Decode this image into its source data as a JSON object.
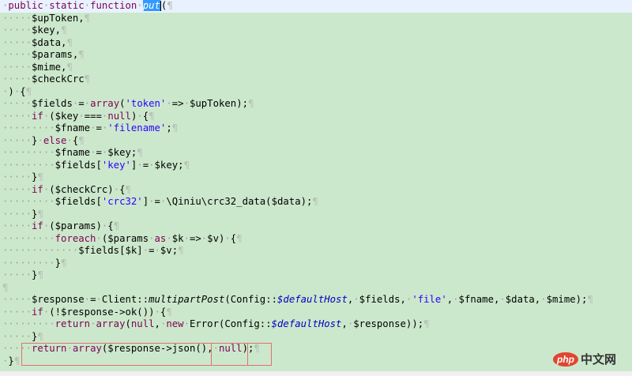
{
  "colors": {
    "keyword": "#7f0055",
    "string": "#2a00ff",
    "static_field": "#0000c0",
    "background": "#cce8cc",
    "selection": "#3399ff",
    "annotation_box": "#e07070"
  },
  "code_lines": [
    {
      "indent": 1,
      "current": true,
      "cursor": true,
      "tokens": [
        [
          "k",
          "public"
        ],
        [
          "w",
          " "
        ],
        [
          "k",
          "static"
        ],
        [
          "w",
          " "
        ],
        [
          "k",
          "function"
        ],
        [
          "w",
          " "
        ],
        [
          "x",
          "put"
        ],
        [
          "p",
          "("
        ]
      ]
    },
    {
      "indent": 5,
      "tokens": [
        [
          "p",
          "$upToken,"
        ]
      ]
    },
    {
      "indent": 5,
      "tokens": [
        [
          "p",
          "$key,"
        ]
      ]
    },
    {
      "indent": 5,
      "tokens": [
        [
          "p",
          "$data,"
        ]
      ]
    },
    {
      "indent": 5,
      "tokens": [
        [
          "p",
          "$params,"
        ]
      ]
    },
    {
      "indent": 5,
      "tokens": [
        [
          "p",
          "$mime,"
        ]
      ]
    },
    {
      "indent": 5,
      "tokens": [
        [
          "p",
          "$checkCrc"
        ]
      ]
    },
    {
      "indent": 1,
      "tokens": [
        [
          "p",
          ")"
        ],
        [
          "w",
          " "
        ],
        [
          "p",
          "{"
        ]
      ]
    },
    {
      "indent": 5,
      "tokens": [
        [
          "p",
          "$fields"
        ],
        [
          "w",
          " "
        ],
        [
          "p",
          "="
        ],
        [
          "w",
          " "
        ],
        [
          "k",
          "array"
        ],
        [
          "p",
          "("
        ],
        [
          "s",
          "'token'"
        ],
        [
          "w",
          " "
        ],
        [
          "p",
          "=>"
        ],
        [
          "w",
          " "
        ],
        [
          "p",
          "$upToken);"
        ]
      ]
    },
    {
      "indent": 5,
      "tokens": [
        [
          "k",
          "if"
        ],
        [
          "w",
          " "
        ],
        [
          "p",
          "($key"
        ],
        [
          "w",
          " "
        ],
        [
          "p",
          "==="
        ],
        [
          "w",
          " "
        ],
        [
          "k",
          "null"
        ],
        [
          "p",
          ")"
        ],
        [
          "w",
          " "
        ],
        [
          "p",
          "{"
        ]
      ]
    },
    {
      "indent": 9,
      "tokens": [
        [
          "p",
          "$fname"
        ],
        [
          "w",
          " "
        ],
        [
          "p",
          "="
        ],
        [
          "w",
          " "
        ],
        [
          "s",
          "'filename'"
        ],
        [
          "p",
          ";"
        ]
      ]
    },
    {
      "indent": 5,
      "tokens": [
        [
          "p",
          "}"
        ],
        [
          "w",
          " "
        ],
        [
          "k",
          "else"
        ],
        [
          "w",
          " "
        ],
        [
          "p",
          "{"
        ]
      ]
    },
    {
      "indent": 9,
      "tokens": [
        [
          "p",
          "$fname"
        ],
        [
          "w",
          " "
        ],
        [
          "p",
          "="
        ],
        [
          "w",
          " "
        ],
        [
          "p",
          "$key;"
        ]
      ]
    },
    {
      "indent": 9,
      "tokens": [
        [
          "p",
          "$fields["
        ],
        [
          "s",
          "'key'"
        ],
        [
          "p",
          "]"
        ],
        [
          "w",
          " "
        ],
        [
          "p",
          "="
        ],
        [
          "w",
          " "
        ],
        [
          "p",
          "$key;"
        ]
      ]
    },
    {
      "indent": 5,
      "tokens": [
        [
          "p",
          "}"
        ]
      ]
    },
    {
      "indent": 5,
      "tokens": [
        [
          "k",
          "if"
        ],
        [
          "w",
          " "
        ],
        [
          "p",
          "($checkCrc)"
        ],
        [
          "w",
          " "
        ],
        [
          "p",
          "{"
        ]
      ]
    },
    {
      "indent": 9,
      "tokens": [
        [
          "p",
          "$fields["
        ],
        [
          "s",
          "'crc32'"
        ],
        [
          "p",
          "]"
        ],
        [
          "w",
          " "
        ],
        [
          "p",
          "="
        ],
        [
          "w",
          " "
        ],
        [
          "p",
          "\\Qiniu\\crc32_data($data);"
        ]
      ]
    },
    {
      "indent": 5,
      "tokens": [
        [
          "p",
          "}"
        ]
      ]
    },
    {
      "indent": 5,
      "tokens": [
        [
          "k",
          "if"
        ],
        [
          "w",
          " "
        ],
        [
          "p",
          "($params)"
        ],
        [
          "w",
          " "
        ],
        [
          "p",
          "{"
        ]
      ]
    },
    {
      "indent": 9,
      "tokens": [
        [
          "k",
          "foreach"
        ],
        [
          "w",
          " "
        ],
        [
          "p",
          "($params"
        ],
        [
          "w",
          " "
        ],
        [
          "k",
          "as"
        ],
        [
          "w",
          " "
        ],
        [
          "p",
          "$k"
        ],
        [
          "w",
          " "
        ],
        [
          "p",
          "=>"
        ],
        [
          "w",
          " "
        ],
        [
          "p",
          "$v)"
        ],
        [
          "w",
          " "
        ],
        [
          "p",
          "{"
        ]
      ]
    },
    {
      "indent": 13,
      "tokens": [
        [
          "p",
          "$fields[$k]"
        ],
        [
          "w",
          " "
        ],
        [
          "p",
          "="
        ],
        [
          "w",
          " "
        ],
        [
          "p",
          "$v;"
        ]
      ]
    },
    {
      "indent": 9,
      "tokens": [
        [
          "p",
          "}"
        ]
      ]
    },
    {
      "indent": 5,
      "tokens": [
        [
          "p",
          "}"
        ]
      ]
    },
    {
      "indent": 0,
      "tokens": []
    },
    {
      "indent": 5,
      "tokens": [
        [
          "p",
          "$response"
        ],
        [
          "w",
          " "
        ],
        [
          "p",
          "="
        ],
        [
          "w",
          " "
        ],
        [
          "p",
          "Client::"
        ],
        [
          "i",
          "multipartPost"
        ],
        [
          "p",
          "(Config::"
        ],
        [
          "f",
          "$defaultHost"
        ],
        [
          "p",
          ","
        ],
        [
          "w",
          " "
        ],
        [
          "p",
          "$fields,"
        ],
        [
          "w",
          " "
        ],
        [
          "s",
          "'file'"
        ],
        [
          "p",
          ","
        ],
        [
          "w",
          " "
        ],
        [
          "p",
          "$fname,"
        ],
        [
          "w",
          " "
        ],
        [
          "p",
          "$data,"
        ],
        [
          "w",
          " "
        ],
        [
          "p",
          "$mime);"
        ]
      ]
    },
    {
      "indent": 5,
      "tokens": [
        [
          "k",
          "if"
        ],
        [
          "w",
          " "
        ],
        [
          "p",
          "(!$response->ok())"
        ],
        [
          "w",
          " "
        ],
        [
          "p",
          "{"
        ]
      ]
    },
    {
      "indent": 9,
      "tokens": [
        [
          "k",
          "return"
        ],
        [
          "w",
          " "
        ],
        [
          "k",
          "array"
        ],
        [
          "p",
          "("
        ],
        [
          "k",
          "null"
        ],
        [
          "p",
          ","
        ],
        [
          "w",
          " "
        ],
        [
          "k",
          "new"
        ],
        [
          "w",
          " "
        ],
        [
          "p",
          "Error(Config::"
        ],
        [
          "f",
          "$defaultHost"
        ],
        [
          "p",
          ","
        ],
        [
          "w",
          " "
        ],
        [
          "p",
          "$response));"
        ]
      ]
    },
    {
      "indent": 5,
      "tokens": [
        [
          "p",
          "}"
        ]
      ]
    },
    {
      "indent": 5,
      "tokens": [
        [
          "k",
          "return"
        ],
        [
          "w",
          " "
        ],
        [
          "k",
          "array"
        ],
        [
          "p",
          "($response->json(),"
        ],
        [
          "w",
          " "
        ],
        [
          "k",
          "null"
        ],
        [
          "p",
          ");"
        ]
      ]
    },
    {
      "indent": 1,
      "tokens": [
        [
          "p",
          "}"
        ]
      ]
    }
  ],
  "pilcrow": "¶",
  "whitespace_dot": "·",
  "watermark": {
    "logo": "php",
    "text": "中文网"
  }
}
